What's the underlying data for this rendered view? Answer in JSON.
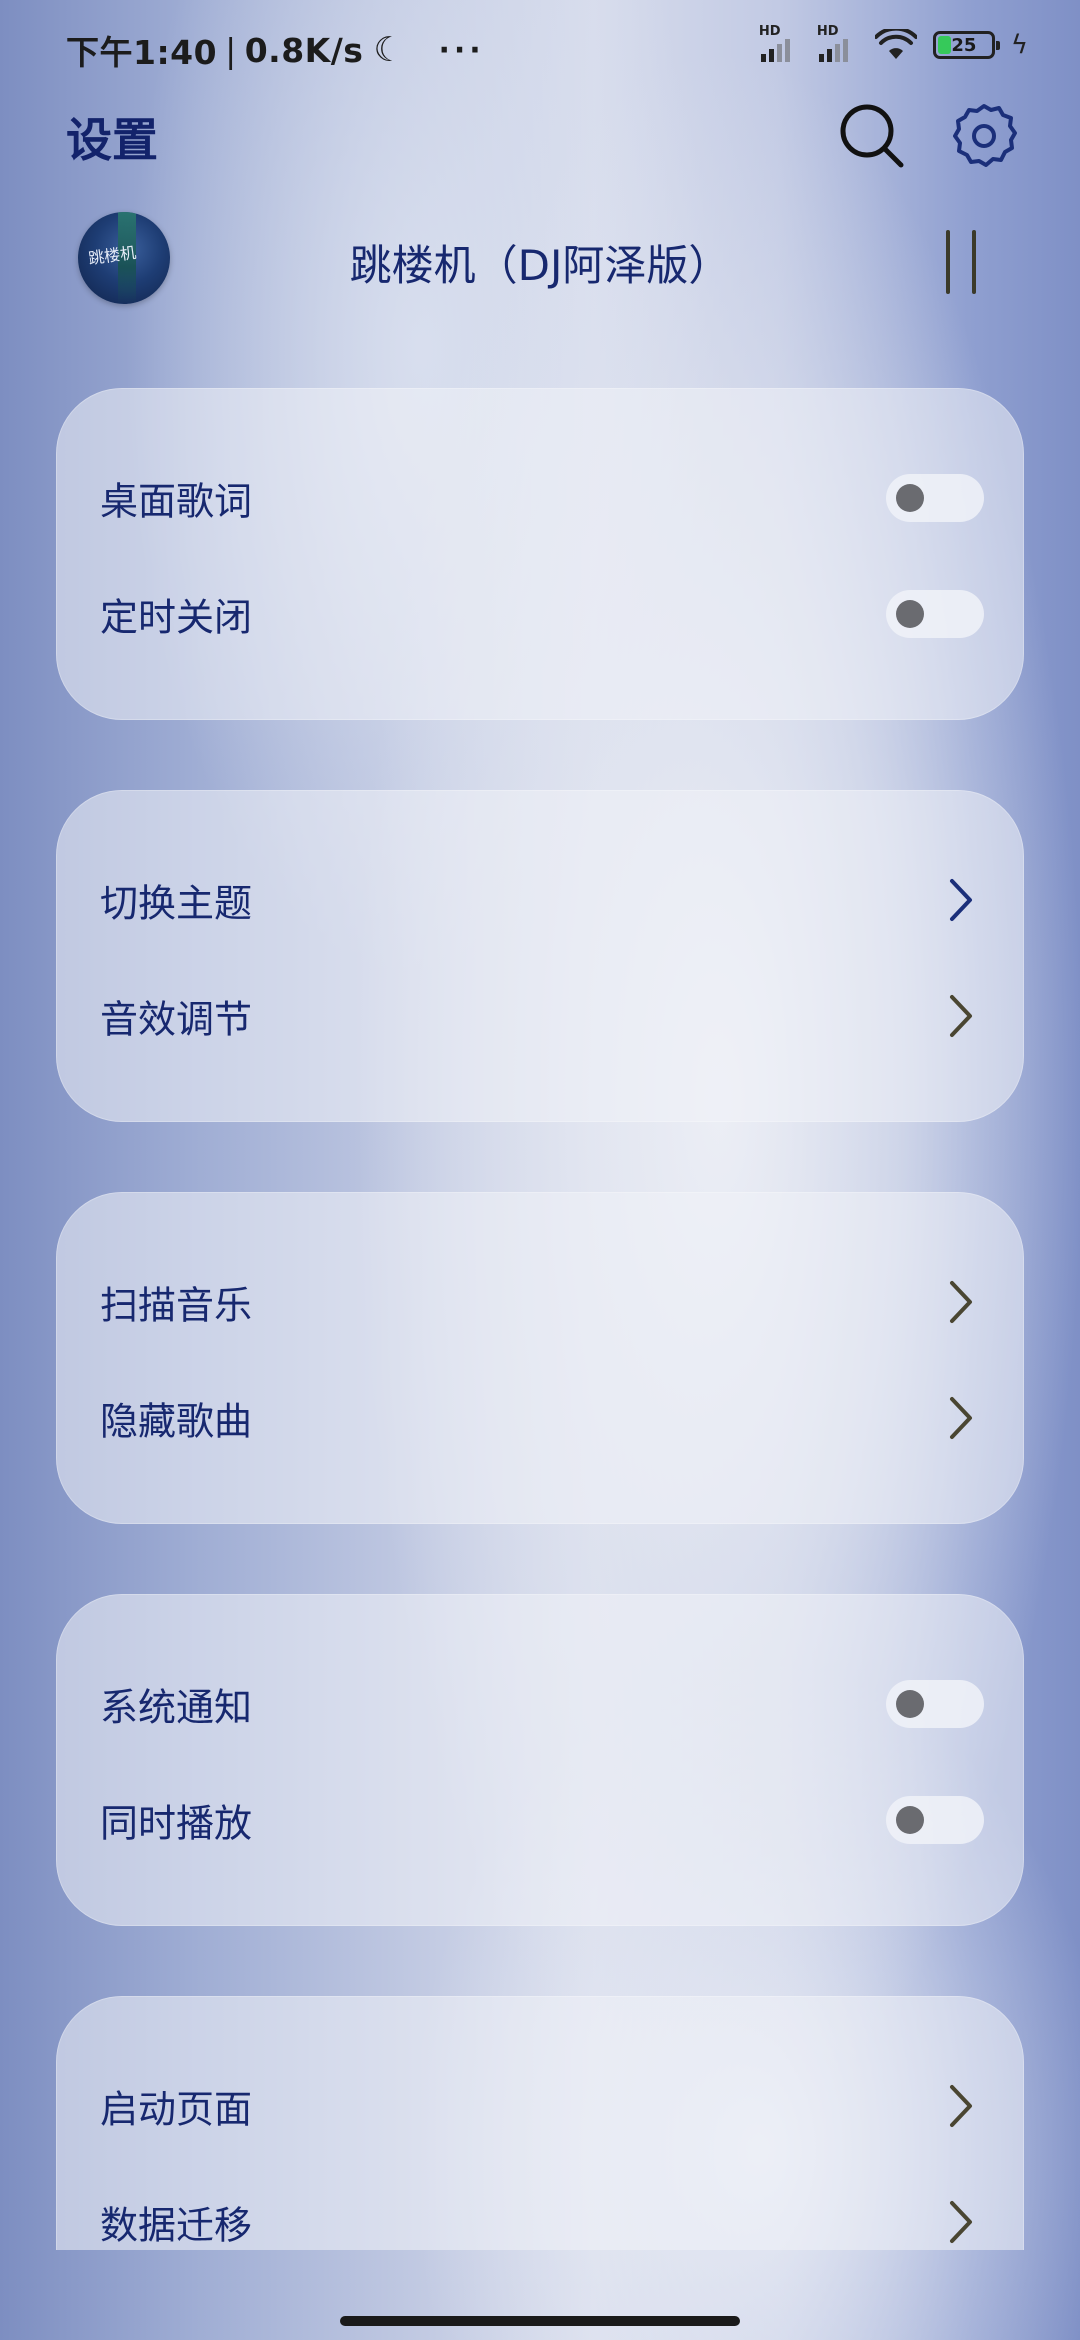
{
  "status_bar": {
    "time": "下午1:40",
    "speed": "0.8K/s",
    "separator": "|",
    "sim1_label": "HD",
    "sim2_label": "HD",
    "battery": "25",
    "more": "···"
  },
  "header": {
    "title": "设置"
  },
  "now_playing": {
    "song_title": "跳楼机（DJ阿泽版）",
    "cover_text": "跳楼机"
  },
  "sections": [
    {
      "rows": [
        {
          "label": "桌面歌词",
          "control": "toggle",
          "on": false
        },
        {
          "label": "定时关闭",
          "control": "toggle",
          "on": false
        }
      ]
    },
    {
      "rows": [
        {
          "label": "切换主题",
          "control": "chevron"
        },
        {
          "label": "音效调节",
          "control": "chevron"
        }
      ]
    },
    {
      "rows": [
        {
          "label": "扫描音乐",
          "control": "chevron"
        },
        {
          "label": "隐藏歌曲",
          "control": "chevron"
        }
      ]
    },
    {
      "rows": [
        {
          "label": "系统通知",
          "control": "toggle",
          "on": false
        },
        {
          "label": "同时播放",
          "control": "toggle",
          "on": false
        }
      ]
    },
    {
      "rows": [
        {
          "label": "启动页面",
          "control": "chevron"
        },
        {
          "label": "数据迁移",
          "control": "chevron"
        }
      ]
    }
  ],
  "icons": {
    "search": "search-icon",
    "settings": "gear-icon",
    "pause": "pause-icon",
    "chevron": "chevron-right-icon",
    "moon": "moon-icon",
    "wifi": "wifi-icon"
  },
  "colors": {
    "accent_text": "#17286f",
    "battery_fill": "#36c95a",
    "toggle_knob": "#6a6b70"
  }
}
